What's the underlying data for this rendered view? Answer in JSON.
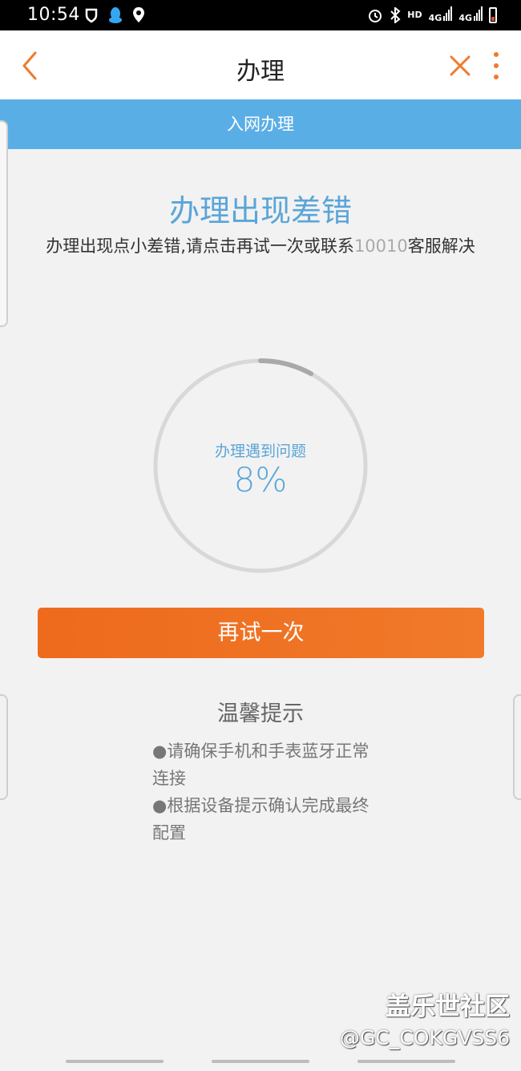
{
  "status_bar": {
    "time": "10:54",
    "hd": "HD",
    "network_1": "4G",
    "network_2": "4G"
  },
  "header": {
    "title": "办理"
  },
  "banner": {
    "text": "入网办理"
  },
  "error": {
    "title": "办理出现差错",
    "desc_prefix": "办理出现点小差错,请点击再试一次或联系",
    "hotline": "10010",
    "desc_suffix": "客服解决"
  },
  "progress": {
    "label": "办理遇到问题",
    "percent_text": "8%",
    "value": 0.08
  },
  "actions": {
    "retry_label": "再试一次"
  },
  "tips": {
    "title": "温馨提示",
    "items": [
      "●请确保手机和手表蓝牙正常连接",
      "●根据设备提示确认完成最终配置"
    ]
  },
  "watermark": {
    "title": "盖乐世社区",
    "user": "@GC_COKGVSS6"
  },
  "colors": {
    "accent_orange": "#ee6a1c",
    "accent_blue": "#5aaee6",
    "text_blue": "#5aa5d8"
  }
}
